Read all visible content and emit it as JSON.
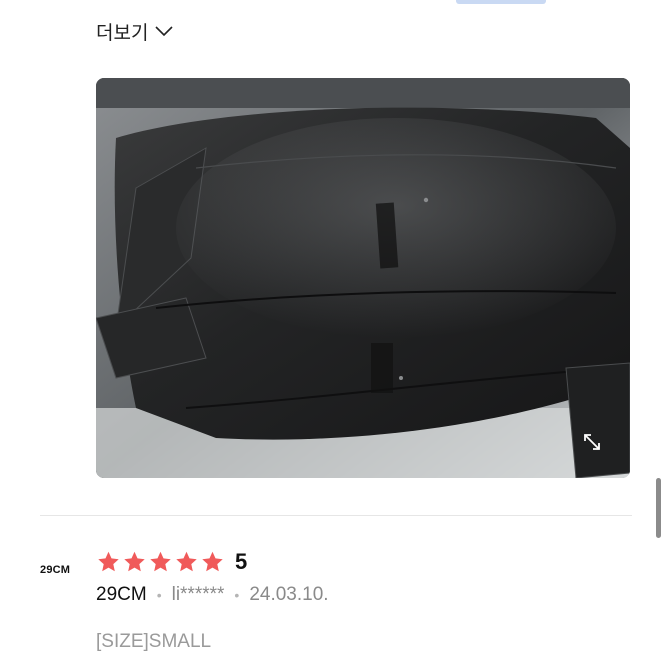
{
  "more": {
    "label": "더보기"
  },
  "review_photo": {
    "subject": "black leather jacket"
  },
  "brand": {
    "logo_text": "29CM"
  },
  "review": {
    "rating": 5,
    "rating_label": "5",
    "source": "29CM",
    "user": "li******",
    "separator": "•",
    "date": "24.03.10.",
    "option": "[SIZE]SMALL"
  },
  "colors": {
    "star": "#f05a5a",
    "accent": "#c9d9f3"
  },
  "icons": {
    "more": "chevron-down-icon",
    "photo": "expand-icon",
    "rating": "star-icon"
  }
}
